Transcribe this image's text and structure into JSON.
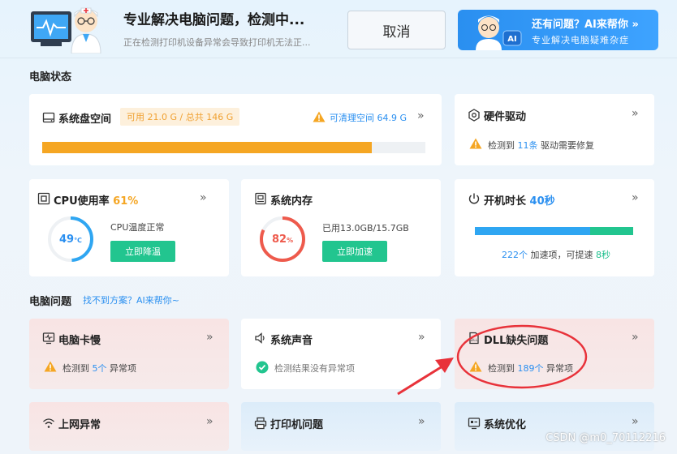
{
  "header": {
    "title": "专业解决电脑问题，检测中...",
    "subtitle": "正在检测打印机设备异常会导致打印机无法正...",
    "cancel_label": "取消"
  },
  "ai_banner": {
    "title": "还有问题？AI来帮你",
    "subtitle": "专业解决电脑疑难杂症",
    "chevron": "»",
    "badge": "AI"
  },
  "status_section": {
    "title": "电脑状态"
  },
  "disk": {
    "title": "系统盘空间",
    "usage_text": "可用 21.0 G / 总共 146 G",
    "cleanable": "可清理空间 64.9 G",
    "used_fraction": 0.86,
    "chevron": "»"
  },
  "hardware": {
    "title": "硬件驱动",
    "prefix": "检测到",
    "count": "11条",
    "suffix": "驱动需要修复",
    "chevron": "»"
  },
  "cpu": {
    "title": "CPU使用率",
    "usage": "61%",
    "temp_value": "49",
    "temp_unit": "℃",
    "temp_fraction": 0.49,
    "status": "CPU温度正常",
    "button": "立即降温",
    "chevron": "»"
  },
  "memory": {
    "title": "系统内存",
    "value": "82",
    "unit": "%",
    "fraction": 0.82,
    "usage_text": "已用13.0GB/15.7GB",
    "button": "立即加速",
    "chevron": "»"
  },
  "boot": {
    "title": "开机时长",
    "value": "40秒",
    "bar_blue_fraction": 0.73,
    "bar_green_fraction": 0.27,
    "count": "222个",
    "middle_text": "加速项，可提速",
    "speedup": "8秒",
    "chevron": "»"
  },
  "problems_section": {
    "title": "电脑问题",
    "link": "找不到方案？AI来帮你~"
  },
  "problems": {
    "lag": {
      "title": "电脑卡慢",
      "prefix": "检测到",
      "count": "5个",
      "suffix": "异常项",
      "chevron": "»"
    },
    "sound": {
      "title": "系统声音",
      "status": "检测结果没有异常项",
      "chevron": "»"
    },
    "dll": {
      "title": "DLL缺失问题",
      "prefix": "检测到",
      "count": "189个",
      "suffix": "异常项",
      "chevron": "»"
    },
    "network": {
      "title": "上网异常",
      "chevron": "»"
    },
    "printer": {
      "title": "打印机问题",
      "chevron": "»"
    },
    "optimize": {
      "title": "系统优化",
      "chevron": "»"
    }
  },
  "watermark": "CSDN @m0_70112216",
  "colors": {
    "accent_blue": "#2a8ff0",
    "warning_orange": "#f5a623",
    "success_green": "#22c58f",
    "danger_red": "#ee5a4c",
    "annotation_red": "#e8323a"
  }
}
